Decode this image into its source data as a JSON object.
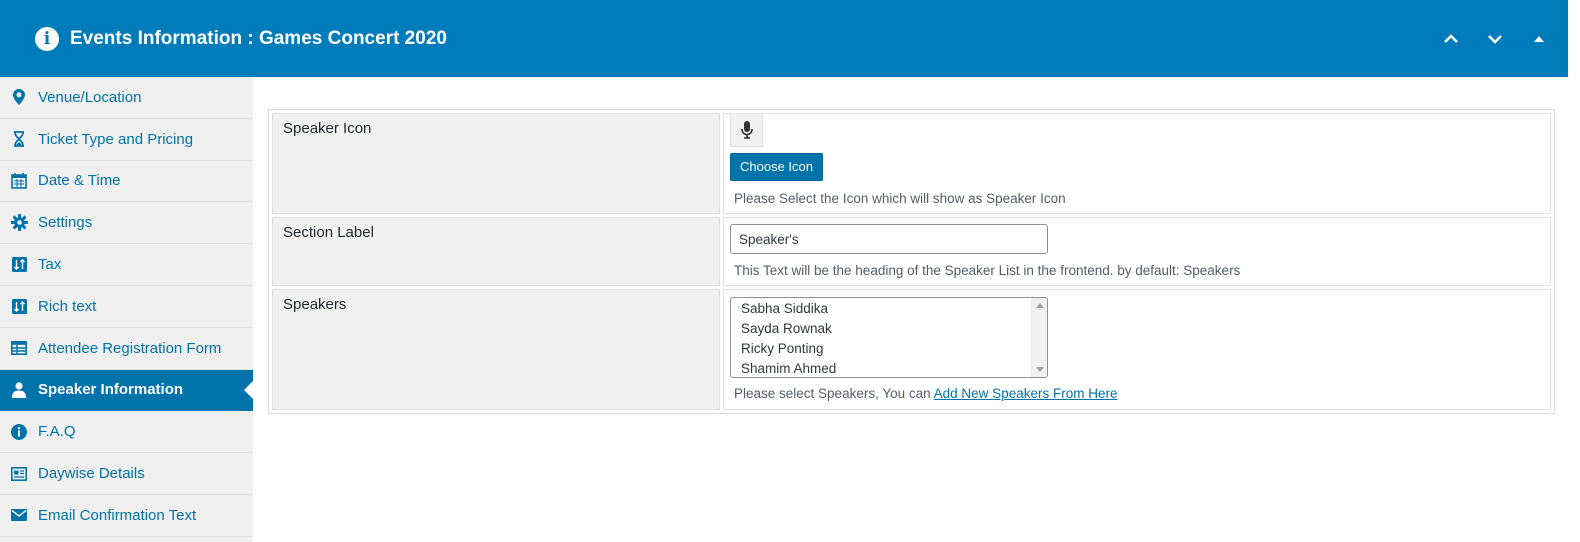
{
  "header": {
    "title": "Events Information : Games Concert 2020",
    "info_icon": "info-circle-icon",
    "buttons": [
      {
        "icon": "chevron-up-icon"
      },
      {
        "icon": "chevron-down-icon"
      },
      {
        "icon": "triangle-up-icon"
      }
    ]
  },
  "sidebar": {
    "items": [
      {
        "label": "Venue/Location",
        "icon": "map-marker-icon"
      },
      {
        "label": "Ticket Type and Pricing",
        "icon": "hourglass-icon"
      },
      {
        "label": "Date & Time",
        "icon": "calendar-icon"
      },
      {
        "label": "Settings",
        "icon": "gear-icon"
      },
      {
        "label": "Tax",
        "icon": "sort-icon"
      },
      {
        "label": "Rich text",
        "icon": "sort-icon"
      },
      {
        "label": "Attendee Registration Form",
        "icon": "table-icon"
      },
      {
        "label": "Speaker Information",
        "icon": "user-icon",
        "active": true
      },
      {
        "label": "F.A.Q",
        "icon": "info-circle-icon"
      },
      {
        "label": "Daywise Details",
        "icon": "newspaper-icon"
      },
      {
        "label": "Email Confirmation Text",
        "icon": "envelope-icon"
      }
    ]
  },
  "form": {
    "speaker_icon": {
      "label": "Speaker Icon",
      "icon": "microphone-icon",
      "button": "Choose Icon",
      "description": "Please Select the Icon which will show as Speaker Icon"
    },
    "section_label": {
      "label": "Section Label",
      "value": "Speaker's",
      "description": "This Text will be the heading of the Speaker List in the frontend. by default: Speakers"
    },
    "speakers": {
      "label": "Speakers",
      "options": [
        "Sabha Siddika",
        "Sayda Rownak",
        "Ricky Ponting",
        "Shamim Ahmed"
      ],
      "description": "Please select Speakers, You can",
      "link": "Add New Speakers From Here"
    }
  },
  "colors": {
    "header_bg": "#007cba",
    "accent": "#0073aa",
    "sidebar_bg": "#f0f0f0"
  }
}
